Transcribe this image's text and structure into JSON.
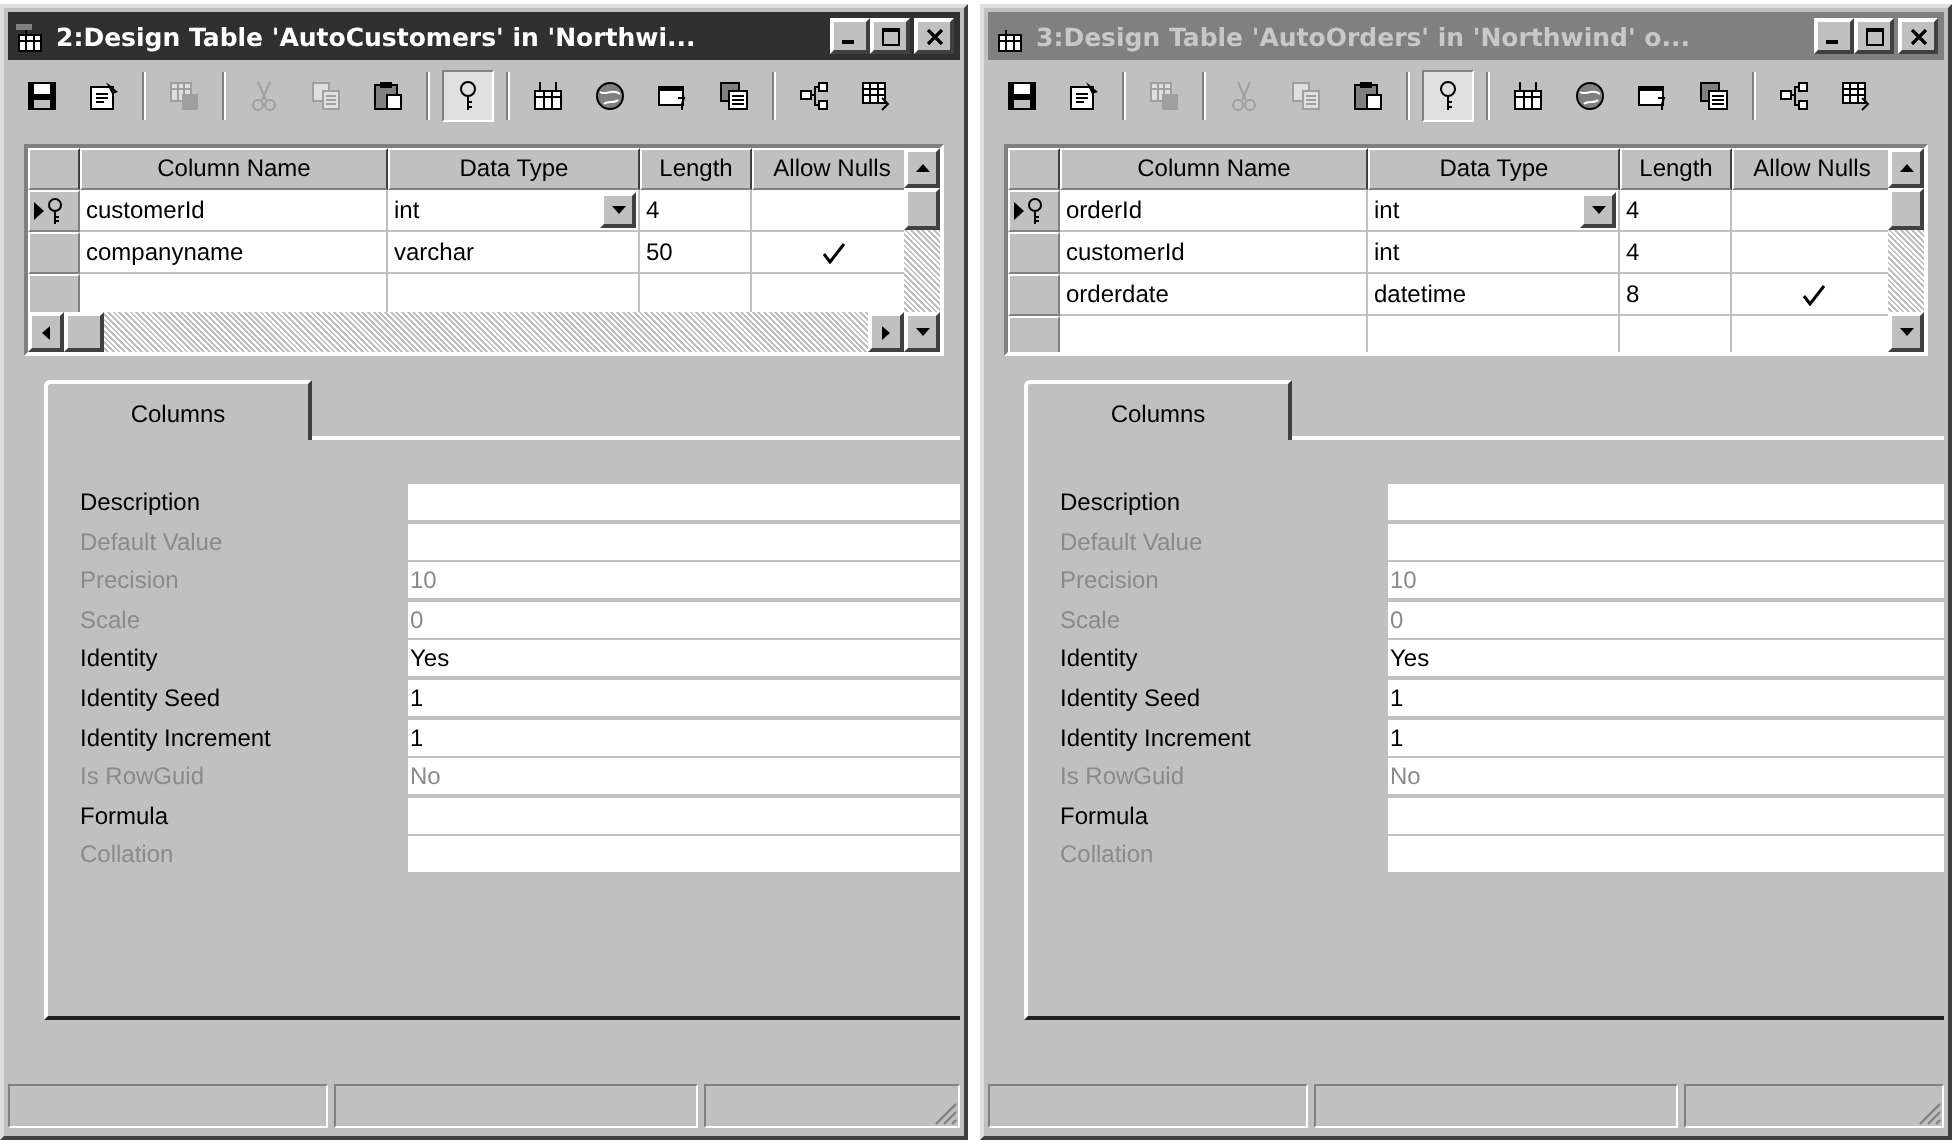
{
  "windows": [
    {
      "title": "2:Design Table 'AutoCustomers' in 'Northwi...",
      "active": true,
      "horizontal_scrollbar": true,
      "toolbar": [
        [
          {
            "kind": "save",
            "disabled": false,
            "pressed": false
          },
          {
            "kind": "properties",
            "disabled": false,
            "pressed": false
          }
        ],
        [
          {
            "kind": "manage",
            "disabled": true,
            "pressed": false
          }
        ],
        [
          {
            "kind": "cut",
            "disabled": true,
            "pressed": false
          },
          {
            "kind": "copy",
            "disabled": true,
            "pressed": false
          },
          {
            "kind": "paste",
            "disabled": false,
            "pressed": false
          }
        ],
        [
          {
            "kind": "key",
            "disabled": false,
            "pressed": true
          }
        ],
        [
          {
            "kind": "indexes",
            "disabled": false,
            "pressed": false
          },
          {
            "kind": "relationships",
            "disabled": false,
            "pressed": false
          },
          {
            "kind": "constraints",
            "disabled": false,
            "pressed": false
          },
          {
            "kind": "triggers",
            "disabled": false,
            "pressed": false
          }
        ],
        [
          {
            "kind": "diagram",
            "disabled": false,
            "pressed": false
          },
          {
            "kind": "script",
            "disabled": false,
            "pressed": false
          }
        ]
      ],
      "grid": {
        "columns": [
          "Column Name",
          "Data Type",
          "Length",
          "Allow Nulls"
        ],
        "rows": [
          {
            "name": "customerId",
            "type": "int",
            "length": "4",
            "allow_nulls": false,
            "current": true,
            "primary_key": true
          },
          {
            "name": "companyname",
            "type": "varchar",
            "length": "50",
            "allow_nulls": true,
            "current": false,
            "primary_key": false
          }
        ]
      },
      "tabs": [
        {
          "label": "Columns",
          "selected": true
        }
      ],
      "properties": [
        {
          "label": "Description",
          "disabled": false
        },
        {
          "label": "Default Value",
          "disabled": true
        },
        {
          "label": "Precision",
          "value": "10",
          "disabled": true
        },
        {
          "label": "Scale",
          "value": "0",
          "disabled": true
        },
        {
          "label": "Identity",
          "value": "Yes",
          "disabled": false
        },
        {
          "label": "Identity Seed",
          "value": "1",
          "disabled": false
        },
        {
          "label": "Identity Increment",
          "value": "1",
          "disabled": false
        },
        {
          "label": "Is RowGuid",
          "value": "No",
          "disabled": true
        },
        {
          "label": "Formula",
          "disabled": false
        },
        {
          "label": "Collation",
          "disabled": true
        }
      ]
    },
    {
      "title": "3:Design Table 'AutoOrders' in 'Northwind' o...",
      "active": false,
      "horizontal_scrollbar": false,
      "toolbar": [
        [
          {
            "kind": "save",
            "disabled": false,
            "pressed": false
          },
          {
            "kind": "properties",
            "disabled": false,
            "pressed": false
          }
        ],
        [
          {
            "kind": "manage",
            "disabled": true,
            "pressed": false
          }
        ],
        [
          {
            "kind": "cut",
            "disabled": true,
            "pressed": false
          },
          {
            "kind": "copy",
            "disabled": true,
            "pressed": false
          },
          {
            "kind": "paste",
            "disabled": false,
            "pressed": false
          }
        ],
        [
          {
            "kind": "key",
            "disabled": false,
            "pressed": true
          }
        ],
        [
          {
            "kind": "indexes",
            "disabled": false,
            "pressed": false
          },
          {
            "kind": "relationships",
            "disabled": false,
            "pressed": false
          },
          {
            "kind": "constraints",
            "disabled": false,
            "pressed": false
          },
          {
            "kind": "triggers",
            "disabled": false,
            "pressed": false
          }
        ],
        [
          {
            "kind": "diagram",
            "disabled": false,
            "pressed": false
          },
          {
            "kind": "script",
            "disabled": false,
            "pressed": false
          }
        ]
      ],
      "grid": {
        "columns": [
          "Column Name",
          "Data Type",
          "Length",
          "Allow Nulls"
        ],
        "rows": [
          {
            "name": "orderId",
            "type": "int",
            "length": "4",
            "allow_nulls": false,
            "current": true,
            "primary_key": true
          },
          {
            "name": "customerId",
            "type": "int",
            "length": "4",
            "allow_nulls": false,
            "current": false,
            "primary_key": false
          },
          {
            "name": "orderdate",
            "type": "datetime",
            "length": "8",
            "allow_nulls": true,
            "current": false,
            "primary_key": false
          }
        ]
      },
      "tabs": [
        {
          "label": "Columns",
          "selected": true
        }
      ],
      "properties": [
        {
          "label": "Description",
          "disabled": false
        },
        {
          "label": "Default Value",
          "disabled": true
        },
        {
          "label": "Precision",
          "value": "10",
          "disabled": true
        },
        {
          "label": "Scale",
          "value": "0",
          "disabled": true
        },
        {
          "label": "Identity",
          "value": "Yes",
          "disabled": false
        },
        {
          "label": "Identity Seed",
          "value": "1",
          "disabled": false
        },
        {
          "label": "Identity Increment",
          "value": "1",
          "disabled": false
        },
        {
          "label": "Is RowGuid",
          "value": "No",
          "disabled": true
        },
        {
          "label": "Formula",
          "disabled": false
        },
        {
          "label": "Collation",
          "disabled": true
        }
      ]
    }
  ]
}
